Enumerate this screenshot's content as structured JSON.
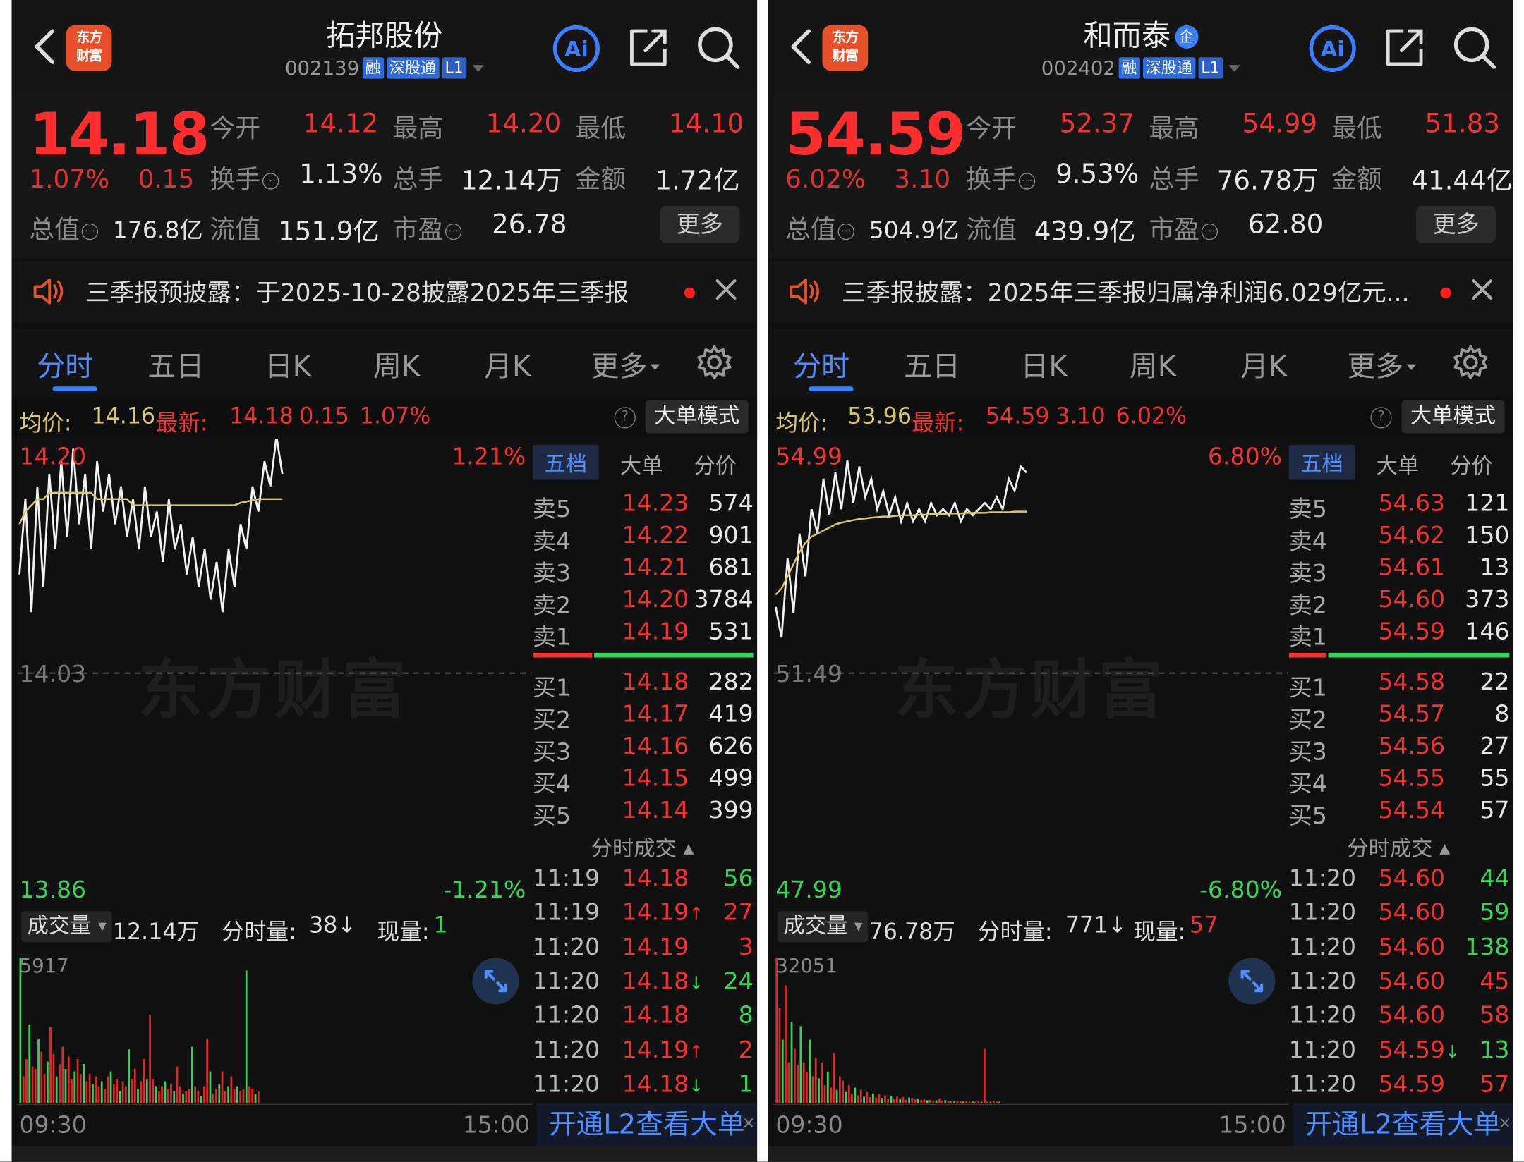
{
  "panels": [
    {
      "name": "拓邦股份",
      "code": "002139",
      "tags": [
        "融",
        "深股通",
        "L1"
      ],
      "badge": "",
      "logo": [
        "东方",
        "财富"
      ],
      "price": "14.18",
      "change_pct": "1.07%",
      "change": "0.15",
      "stats": {
        "open_label": "今开",
        "open": "14.12",
        "high_label": "最高",
        "high": "14.20",
        "low_label": "最低",
        "low": "14.10",
        "turnover_label": "换手",
        "turnover": "1.13%",
        "volume_label": "总手",
        "volume": "12.14万",
        "amount_label": "金额",
        "amount": "1.72亿",
        "mktcap_label": "总值",
        "mktcap": "176.8亿",
        "float_label": "流值",
        "float": "151.9亿",
        "pe_label": "市盈",
        "pe": "26.78",
        "more": "更多"
      },
      "notice": "三季报预披露：于2025-10-28披露2025年三季报",
      "tabs": [
        "分时",
        "五日",
        "日K",
        "周K",
        "月K",
        "更多"
      ],
      "avgbar": {
        "avg_label": "均价:",
        "avg": "14.16",
        "latest_label": "最新:",
        "latest": "14.18",
        "chg": "0.15",
        "pct": "1.07%",
        "mode": "大单模式",
        "help": "?"
      },
      "chart_labels": {
        "top": "14.20",
        "mid": "14.03",
        "bottom": "13.86",
        "top_pct": "1.21%",
        "bottom_pct": "-1.21%",
        "watermark": "东方财富"
      },
      "chart_data": {
        "type": "line",
        "series": [
          {
            "values": [
              14.1,
              14.16,
              14.07,
              14.17,
              14.09,
              14.18,
              14.12,
              14.19,
              14.13,
              14.2,
              14.14,
              14.18,
              14.12,
              14.19,
              14.15,
              14.18,
              14.14,
              14.17,
              14.13,
              14.16,
              14.12,
              14.17,
              14.13,
              14.15,
              14.11,
              14.16,
              14.12,
              14.14,
              14.1,
              14.13,
              14.09,
              14.12,
              14.08,
              14.11,
              14.07,
              14.12,
              14.09,
              14.14,
              14.12,
              14.17,
              14.15,
              14.19,
              14.17,
              14.21,
              14.18
            ]
          },
          {
            "values": [
              14.14,
              14.15,
              14.155,
              14.16,
              14.16,
              14.165,
              14.165,
              14.165,
              14.165,
              14.165,
              14.165,
              14.165,
              14.165,
              14.16,
              14.16,
              14.16,
              14.16,
              14.16,
              14.16,
              14.155,
              14.155,
              14.155,
              14.155,
              14.155,
              14.155,
              14.155,
              14.155,
              14.155,
              14.155,
              14.155,
              14.155,
              14.155,
              14.155,
              14.155,
              14.155,
              14.155,
              14.155,
              14.157,
              14.158,
              14.159,
              14.16,
              14.16,
              14.16,
              14.16,
              14.16
            ]
          }
        ],
        "ylim": [
          13.86,
          14.2
        ]
      },
      "orderbook": {
        "tabs": [
          "五档",
          "大单",
          "分价"
        ],
        "asks": [
          [
            "卖5",
            "14.23",
            "574"
          ],
          [
            "卖4",
            "14.22",
            "901"
          ],
          [
            "卖3",
            "14.21",
            "681"
          ],
          [
            "卖2",
            "14.20",
            "3784"
          ],
          [
            "卖1",
            "14.19",
            "531"
          ]
        ],
        "bids": [
          [
            "买1",
            "14.18",
            "282"
          ],
          [
            "买2",
            "14.17",
            "419"
          ],
          [
            "买3",
            "14.16",
            "626"
          ],
          [
            "买4",
            "14.15",
            "499"
          ],
          [
            "买5",
            "14.14",
            "399"
          ]
        ],
        "split": {
          "red": 0.27,
          "green": 0.73
        },
        "trades_label": "分时成交",
        "trades": [
          [
            "11:19",
            "14.18",
            "",
            "56",
            "g"
          ],
          [
            "11:19",
            "14.19",
            "↑",
            "27",
            "r"
          ],
          [
            "11:20",
            "14.19",
            "",
            "3",
            "r"
          ],
          [
            "11:20",
            "14.18",
            "↓",
            "24",
            "g"
          ],
          [
            "11:20",
            "14.18",
            "",
            "8",
            "g"
          ],
          [
            "11:20",
            "14.19",
            "↑",
            "2",
            "r"
          ],
          [
            "11:20",
            "14.18",
            "↓",
            "1",
            "g"
          ]
        ]
      },
      "volume": {
        "btn": "成交量",
        "total": "12.14万",
        "tick_label": "分时量:",
        "tick": "38↓",
        "now_label": "现量:",
        "now": "1",
        "now_color": "g",
        "max": "5917"
      },
      "volume_data": [
        5917,
        1100,
        1800,
        3200,
        1500,
        1400,
        2600,
        2100,
        1200,
        1700,
        3100,
        2000,
        1100,
        1600,
        2300,
        1400,
        1900,
        1000,
        1300,
        1800,
        1200,
        1600,
        900,
        1200,
        800,
        1100,
        700,
        900,
        600,
        1100,
        1300,
        800,
        1000,
        500,
        900,
        700,
        2200,
        1000,
        1400,
        600,
        900,
        1800,
        1000,
        3600,
        1000,
        700,
        500,
        700,
        900,
        600,
        800,
        500,
        1500,
        700,
        400,
        500,
        600,
        2300,
        700,
        500,
        300,
        700,
        2600,
        1300,
        400,
        600,
        800,
        1300,
        500,
        700,
        1100,
        600,
        700,
        500,
        600,
        5400,
        700,
        600,
        400,
        500
      ],
      "time": {
        "start": "09:30",
        "end": "15:00"
      },
      "l2": "开通L2查看大单",
      "l2close": "×"
    },
    {
      "name": "和而泰",
      "code": "002402",
      "tags": [
        "融",
        "深股通",
        "L1"
      ],
      "badge": "企",
      "logo": [
        "东方",
        "财富"
      ],
      "price": "54.59",
      "change_pct": "6.02%",
      "change": "3.10",
      "stats": {
        "open_label": "今开",
        "open": "52.37",
        "high_label": "最高",
        "high": "54.99",
        "low_label": "最低",
        "low": "51.83",
        "turnover_label": "换手",
        "turnover": "9.53%",
        "volume_label": "总手",
        "volume": "76.78万",
        "amount_label": "金额",
        "amount": "41.44亿",
        "mktcap_label": "总值",
        "mktcap": "504.9亿",
        "float_label": "流值",
        "float": "439.9亿",
        "pe_label": "市盈",
        "pe": "62.80",
        "more": "更多"
      },
      "notice": "三季报披露：2025年三季报归属净利润6.029亿元...",
      "tabs": [
        "分时",
        "五日",
        "日K",
        "周K",
        "月K",
        "更多"
      ],
      "avgbar": {
        "avg_label": "均价:",
        "avg": "53.96",
        "latest_label": "最新:",
        "latest": "54.59",
        "chg": "3.10",
        "pct": "6.02%",
        "mode": "大单模式",
        "help": "?"
      },
      "chart_labels": {
        "top": "54.99",
        "mid": "51.49",
        "bottom": "47.99",
        "top_pct": "6.80%",
        "bottom_pct": "-6.80%",
        "watermark": "东方财富"
      },
      "chart_data": {
        "type": "line",
        "series": [
          {
            "values": [
              52.4,
              51.9,
              53.2,
              52.3,
              53.6,
              52.9,
              54.0,
              53.6,
              54.5,
              53.9,
              54.6,
              54.0,
              54.8,
              54.1,
              54.7,
              54.2,
              54.5,
              54.0,
              54.3,
              53.9,
              54.2,
              53.8,
              54.1,
              53.8,
              54.0,
              53.8,
              54.1,
              53.9,
              54.0,
              53.9,
              54.1,
              53.8,
              54.0,
              53.9,
              54.0,
              54.1,
              54.0,
              54.2,
              54.0,
              54.5,
              54.3,
              54.7,
              54.6
            ]
          },
          {
            "values": [
              52.6,
              52.7,
              52.9,
              53.1,
              53.3,
              53.45,
              53.55,
              53.6,
              53.65,
              53.7,
              53.75,
              53.78,
              53.8,
              53.82,
              53.84,
              53.85,
              53.86,
              53.87,
              53.88,
              53.88,
              53.89,
              53.9,
              53.9,
              53.9,
              53.91,
              53.91,
              53.92,
              53.92,
              53.92,
              53.93,
              53.93,
              53.93,
              53.94,
              53.94,
              53.94,
              53.94,
              53.95,
              53.95,
              53.95,
              53.95,
              53.96,
              53.96,
              53.96
            ]
          }
        ],
        "ylim": [
          47.99,
          54.99
        ]
      },
      "orderbook": {
        "tabs": [
          "五档",
          "大单",
          "分价"
        ],
        "asks": [
          [
            "卖5",
            "54.63",
            "121"
          ],
          [
            "卖4",
            "54.62",
            "150"
          ],
          [
            "卖3",
            "54.61",
            "13"
          ],
          [
            "卖2",
            "54.60",
            "373"
          ],
          [
            "卖1",
            "54.59",
            "146"
          ]
        ],
        "bids": [
          [
            "买1",
            "54.58",
            "22"
          ],
          [
            "买2",
            "54.57",
            "8"
          ],
          [
            "买3",
            "54.56",
            "27"
          ],
          [
            "买4",
            "54.55",
            "55"
          ],
          [
            "买5",
            "54.54",
            "57"
          ]
        ],
        "split": {
          "red": 0.17,
          "green": 0.83
        },
        "trades_label": "分时成交",
        "trades": [
          [
            "11:20",
            "54.60",
            "",
            "44",
            "g"
          ],
          [
            "11:20",
            "54.60",
            "",
            "59",
            "g"
          ],
          [
            "11:20",
            "54.60",
            "",
            "138",
            "g"
          ],
          [
            "11:20",
            "54.60",
            "",
            "45",
            "r"
          ],
          [
            "11:20",
            "54.60",
            "",
            "58",
            "r"
          ],
          [
            "11:20",
            "54.59",
            "↓",
            "13",
            "g"
          ],
          [
            "11:20",
            "54.59",
            "",
            "57",
            "r"
          ]
        ]
      },
      "volume": {
        "btn": "成交量",
        "total": "76.78万",
        "tick_label": "分时量:",
        "tick": "771↓",
        "now_label": "现量:",
        "now": "57",
        "now_color": "r",
        "max": "32051"
      },
      "volume_data": [
        32051,
        21000,
        14000,
        26000,
        9000,
        18000,
        12000,
        8500,
        17000,
        9000,
        7000,
        14000,
        6000,
        10000,
        5500,
        9000,
        4000,
        7000,
        3500,
        11000,
        3000,
        6000,
        5000,
        2500,
        4000,
        2000,
        3500,
        1800,
        3000,
        1500,
        2500,
        1400,
        2200,
        1300,
        2000,
        1200,
        1800,
        1100,
        1600,
        1000,
        1500,
        900,
        1400,
        800,
        1300,
        1200,
        900,
        1000,
        800,
        900,
        700,
        800,
        600,
        700,
        1100,
        600,
        700,
        500,
        600,
        500,
        500,
        450,
        400,
        500,
        400,
        450,
        380,
        420,
        360,
        12000,
        400,
        350,
        500,
        420,
        380
      ],
      "time": {
        "start": "09:30",
        "end": "15:00"
      },
      "l2": "开通L2查看大单",
      "l2close": "×"
    }
  ],
  "colors": {
    "up": "#f03232",
    "down": "#35d45a",
    "accent": "#3d7eff",
    "avg_line": "#d8c86a"
  }
}
